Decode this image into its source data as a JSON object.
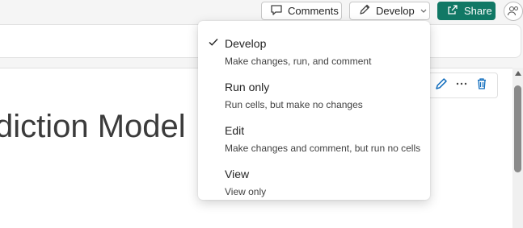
{
  "toolbar": {
    "comments_label": "Comments",
    "develop_label": "Develop",
    "share_label": "Share"
  },
  "notebook": {
    "cell_title": "diction Model"
  },
  "mode_menu": {
    "items": [
      {
        "title": "Develop",
        "description": "Make changes, run, and comment",
        "selected": true
      },
      {
        "title": "Run only",
        "description": "Run cells, but make no changes",
        "selected": false
      },
      {
        "title": "Edit",
        "description": "Make changes and comment, but run no cells",
        "selected": false
      },
      {
        "title": "View",
        "description": "View only",
        "selected": false
      }
    ]
  },
  "colors": {
    "share_button": "#117865",
    "accent_blue": "#0f6cbd"
  }
}
